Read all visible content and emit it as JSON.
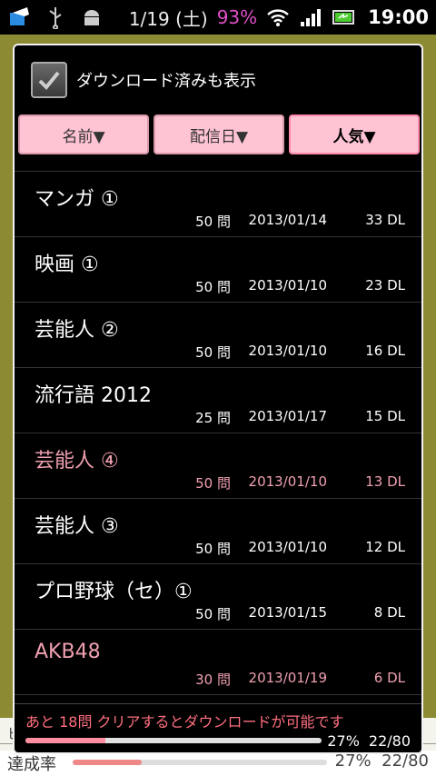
{
  "status_bar": {
    "date": "1/19 (土)",
    "battery": "93%",
    "time": "19:00",
    "icons": [
      "app-icon",
      "usb-icon",
      "android-debug-icon",
      "wifi-icon",
      "signal-icon",
      "battery-icon"
    ]
  },
  "background": {
    "fragment": "ビ",
    "label": "達成率",
    "percent": "27%",
    "count": "22/80",
    "progress": 0.27
  },
  "dialog": {
    "checkbox_label": "ダウンロード済みも表示",
    "checkbox_checked": true,
    "sort_buttons": [
      "名前▼",
      "配信日▼",
      "人気▼"
    ],
    "items": [
      {
        "title": "マンガ ①",
        "questions": "50 問",
        "date": "2013/01/14",
        "downloads": "33 DL",
        "done": false
      },
      {
        "title": "映画 ①",
        "questions": "50 問",
        "date": "2013/01/10",
        "downloads": "23 DL",
        "done": false
      },
      {
        "title": "芸能人 ②",
        "questions": "50 問",
        "date": "2013/01/10",
        "downloads": "16 DL",
        "done": false
      },
      {
        "title": "流行語 2012",
        "questions": "25 問",
        "date": "2013/01/17",
        "downloads": "15 DL",
        "done": false
      },
      {
        "title": "芸能人 ④",
        "questions": "50 問",
        "date": "2013/01/10",
        "downloads": "13 DL",
        "done": true
      },
      {
        "title": "芸能人 ③",
        "questions": "50 問",
        "date": "2013/01/10",
        "downloads": "12 DL",
        "done": false
      },
      {
        "title": "プロ野球（セ）①",
        "questions": "50 問",
        "date": "2013/01/15",
        "downloads": "8 DL",
        "done": false
      },
      {
        "title": "AKB48",
        "questions": "30 問",
        "date": "2013/01/19",
        "downloads": "6 DL",
        "done": true
      }
    ],
    "footer": {
      "message": "あと 18問 クリアするとダウンロードが可能です",
      "percent": "27%",
      "count": "22/80",
      "progress": 0.27
    }
  },
  "colors": {
    "sort_button_bg": "#ffc4d4",
    "done_text": "#f0a0b0",
    "footer_message": "#ff6f7f",
    "battery_text": "#e050c8"
  }
}
